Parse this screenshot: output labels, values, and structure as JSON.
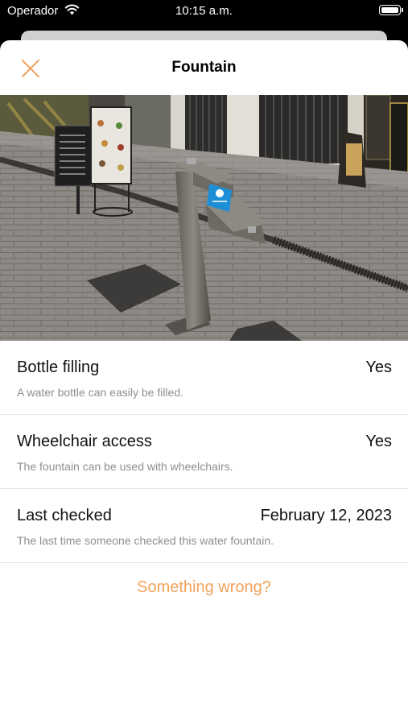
{
  "status_bar": {
    "carrier": "Operador",
    "time": "10:15 a.m.",
    "wifi_icon": "wifi-icon",
    "battery_icon": "battery-icon"
  },
  "sheet": {
    "title": "Fountain",
    "close_icon": "close-icon",
    "accent_color": "#f2a25b"
  },
  "photo": {
    "alt": "photo of a public drinking fountain on a paved street"
  },
  "details": [
    {
      "label": "Bottle filling",
      "value": "Yes",
      "description": "A water bottle can easily be filled."
    },
    {
      "label": "Wheelchair access",
      "value": "Yes",
      "description": "The fountain can be used with wheelchairs."
    },
    {
      "label": "Last checked",
      "value": "February 12, 2023",
      "description": "The last time someone checked this water fountain."
    }
  ],
  "report_link": "Something wrong?"
}
